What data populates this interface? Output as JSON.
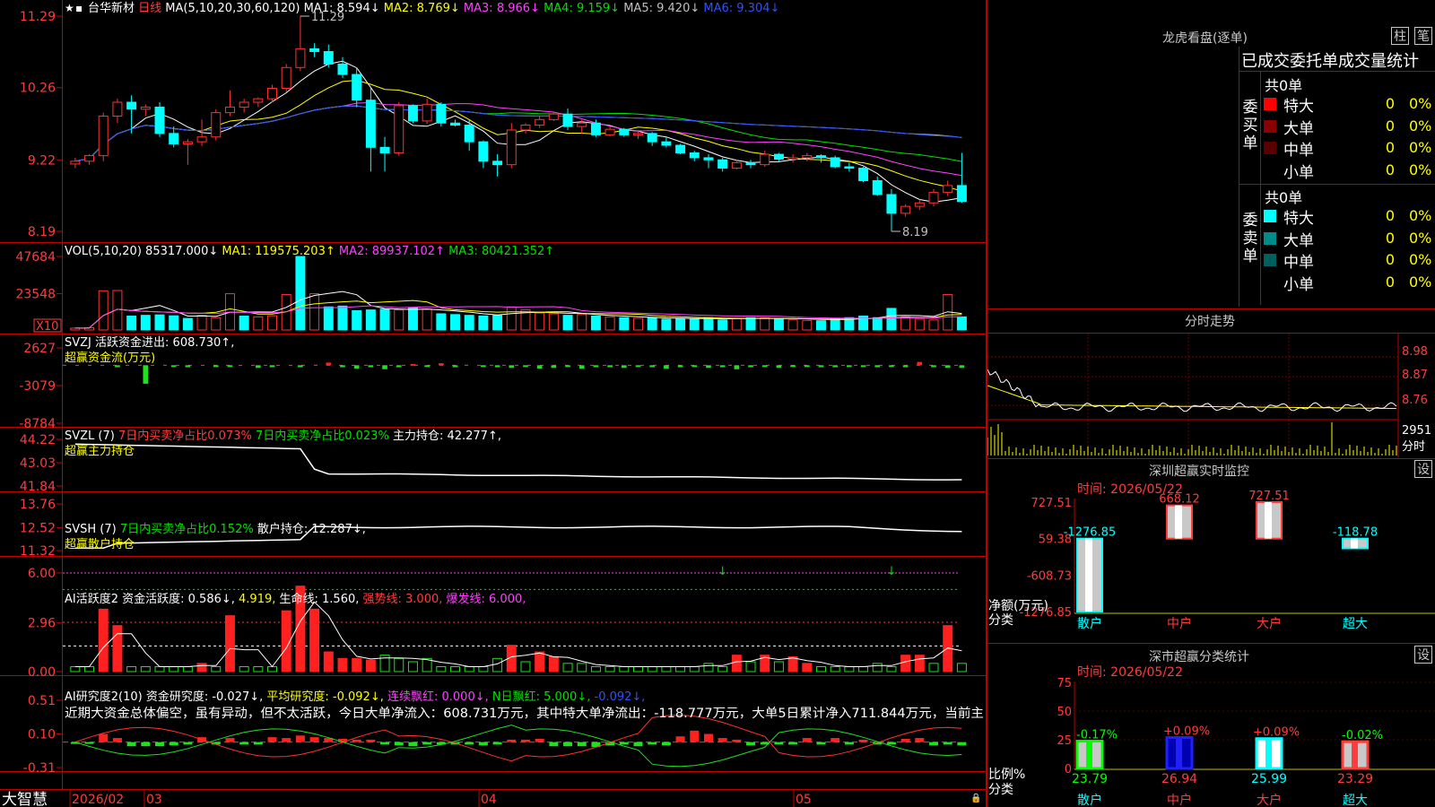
{
  "main": {
    "stock_name": "台华新材",
    "period": "日线",
    "ma_label": "MA(5,10,20,30,60,120)",
    "ma_items": [
      {
        "label": "MA1:",
        "value": "8.594↓",
        "color": "#ffffff"
      },
      {
        "label": "MA2:",
        "value": "8.769↓",
        "color": "#ffff00"
      },
      {
        "label": "MA3:",
        "value": "8.966↓",
        "color": "#ff40ff"
      },
      {
        "label": "MA4:",
        "value": "9.159↓",
        "color": "#00e000"
      },
      {
        "label": "MA5:",
        "value": "9.420↓",
        "color": "#c0c0c0"
      },
      {
        "label": "MA6:",
        "value": "9.304↓",
        "color": "#3050ff"
      }
    ],
    "y_ticks": [
      "11.29",
      "10.26",
      "9.22",
      "8.19"
    ],
    "high_label": "11.29",
    "low_label": "8.19"
  },
  "vol": {
    "header": "VOL(5,10,20)",
    "value": "85317.000↓",
    "ma1": "MA1: 119575.203↑",
    "ma2": "MA2: 89937.102↑",
    "ma3": "MA3: 80421.352↑",
    "y_ticks": [
      "47684",
      "23548"
    ],
    "unit": "X10"
  },
  "svzj": {
    "header": "SVZJ",
    "item": "活跃资金进出: 608.730↑,",
    "sub": "超赢资金流(万元)",
    "y_ticks": [
      "2627",
      "-3079",
      "-8784"
    ]
  },
  "svzl": {
    "header": "SVZL (7)",
    "item1": "7日内买卖净占比0.073%",
    "item2": "7日内买卖净占比0.023%",
    "item3": "主力持仓: 42.277↑,",
    "sub": "超赢主力持仓",
    "y_ticks": [
      "44.22",
      "43.03",
      "41.84"
    ]
  },
  "svsh": {
    "header": "SVSH (7)",
    "item1": "7日内买卖净占比0.152%",
    "item2": "散户持仓: 12.287↓,",
    "sub": "超赢散户持仓",
    "y_ticks": [
      "13.76",
      "12.52",
      "11.32"
    ]
  },
  "aihyd": {
    "header": "AI活跃度2",
    "item1": "资金活跃度: 0.586↓,",
    "item2": "4.919,",
    "item3": "生命线: 1.560,",
    "item4": "强势线: 3.000,",
    "item5": "爆发线: 6.000,",
    "y_ticks": [
      "6.00",
      "2.96",
      "0.00"
    ]
  },
  "aiyjd": {
    "header": "AI研究度2(10)",
    "item1": "资金研究度: -0.027↓,",
    "item2": "平均研究度: -0.092↓,",
    "item3": "连续飘红: 0.000↓,",
    "item4": "N日飘红: 5.000↓,",
    "item5": "-0.092↓,",
    "comment": "近期大资金总体偏空，虽有异动，但不太活跃，今日大单净流入：608.731万元，其中特大单净流出：-118.777万元，大单5日累计净入711.844万元，当前主",
    "y_ticks": [
      "0.51",
      "0.10",
      "-0.31"
    ]
  },
  "xaxis": {
    "brand": "大智慧",
    "labels": [
      "2026/02",
      "03",
      "04",
      "05"
    ]
  },
  "lhp": {
    "title": "龙虎看盘(逐单)",
    "tab1": "柱",
    "tab2": "笔",
    "heading": "已成交委托单成交量统计",
    "buy": {
      "vert": "委买单",
      "total": "共0单",
      "rows": [
        {
          "label": "特大",
          "value": "0",
          "pct": "0%",
          "color": "#ff0000"
        },
        {
          "label": "大单",
          "value": "0",
          "pct": "0%",
          "color": "#8b0000"
        },
        {
          "label": "中单",
          "value": "0",
          "pct": "0%",
          "color": "#5a0000"
        },
        {
          "label": "小单",
          "value": "0",
          "pct": "0%",
          "color": "#000000"
        }
      ]
    },
    "sell": {
      "vert": "委卖单",
      "total": "共0单",
      "rows": [
        {
          "label": "特大",
          "value": "0",
          "pct": "0%",
          "color": "#00ffff"
        },
        {
          "label": "大单",
          "value": "0",
          "pct": "0%",
          "color": "#008b8b"
        },
        {
          "label": "中单",
          "value": "0",
          "pct": "0%",
          "color": "#006060"
        },
        {
          "label": "小单",
          "value": "0",
          "pct": "0%",
          "color": "#000000"
        }
      ]
    }
  },
  "intraday": {
    "title": "分时走势",
    "price_ticks": [
      "8.98",
      "8.87",
      "8.76"
    ],
    "vol_tick": "2951",
    "unit": "分时"
  },
  "sz_monitor": {
    "title": "深圳超赢实时监控",
    "settings": "设",
    "time": "时间: 2026/05/22",
    "y_ticks": [
      "727.51",
      "59.38",
      "-608.73",
      "-1276.85"
    ],
    "ylabel": "净额(万元)",
    "xlabel": "分类",
    "categories": [
      "散户",
      "中户",
      "大户",
      "超大"
    ],
    "value_labels": [
      "-1276.85",
      "668.12",
      "727.51",
      "-118.78"
    ]
  },
  "sz_stats": {
    "title": "深市超赢分类统计",
    "settings": "设",
    "time": "时间: 2026/05/22",
    "y_ticks": [
      "75",
      "50",
      "25",
      "0"
    ],
    "ylabel": "比例%",
    "xlabel": "分类",
    "categories": [
      "散户",
      "中户",
      "大户",
      "超大"
    ],
    "pct_labels": [
      "-0.17%",
      "+0.09%",
      "+0.09%",
      "-0.02%"
    ],
    "value_labels": [
      "23.79",
      "26.94",
      "25.99",
      "23.29"
    ]
  },
  "chart_data": [
    {
      "type": "candlestick",
      "title": "台华新材 日线",
      "ylim": [
        8.19,
        11.29
      ],
      "ohlc": [
        [
          9.16,
          9.25,
          9.1,
          9.2
        ],
        [
          9.2,
          9.3,
          9.15,
          9.28
        ],
        [
          9.28,
          9.9,
          9.2,
          9.85
        ],
        [
          9.85,
          10.1,
          9.75,
          10.05
        ],
        [
          10.05,
          10.15,
          9.6,
          9.95
        ],
        [
          9.95,
          10.02,
          9.85,
          9.98
        ],
        [
          9.98,
          10.05,
          9.55,
          9.6
        ],
        [
          9.6,
          9.7,
          9.4,
          9.45
        ],
        [
          9.45,
          9.52,
          9.15,
          9.48
        ],
        [
          9.48,
          9.8,
          9.42,
          9.55
        ],
        [
          9.55,
          9.95,
          9.5,
          9.9
        ],
        [
          9.9,
          10.22,
          9.85,
          9.98
        ],
        [
          9.98,
          10.1,
          9.9,
          10.05
        ],
        [
          10.05,
          10.12,
          9.98,
          10.1
        ],
        [
          10.1,
          10.3,
          10.05,
          10.25
        ],
        [
          10.25,
          10.6,
          10.2,
          10.55
        ],
        [
          10.55,
          11.29,
          10.5,
          10.82
        ],
        [
          10.82,
          10.9,
          10.7,
          10.78
        ],
        [
          10.78,
          10.88,
          10.55,
          10.6
        ],
        [
          10.6,
          10.7,
          10.4,
          10.45
        ],
        [
          10.45,
          10.55,
          9.98,
          10.08
        ],
        [
          10.08,
          10.25,
          9.05,
          9.4
        ],
        [
          9.4,
          9.55,
          9.05,
          9.32
        ],
        [
          9.32,
          10.05,
          9.28,
          10.0
        ],
        [
          10.0,
          10.02,
          9.75,
          9.78
        ],
        [
          9.78,
          10.1,
          9.74,
          10.02
        ],
        [
          10.02,
          10.05,
          9.7,
          9.75
        ],
        [
          9.75,
          9.8,
          9.7,
          9.72
        ],
        [
          9.72,
          9.8,
          9.35,
          9.48
        ],
        [
          9.48,
          9.5,
          9.1,
          9.2
        ],
        [
          9.2,
          9.3,
          8.98,
          9.15
        ],
        [
          9.15,
          9.75,
          9.1,
          9.65
        ],
        [
          9.65,
          9.75,
          9.6,
          9.72
        ],
        [
          9.72,
          9.85,
          9.68,
          9.8
        ],
        [
          9.8,
          9.9,
          9.78,
          9.88
        ],
        [
          9.88,
          9.96,
          9.65,
          9.7
        ],
        [
          9.7,
          9.8,
          9.6,
          9.75
        ],
        [
          9.75,
          9.8,
          9.55,
          9.58
        ],
        [
          9.58,
          9.7,
          9.56,
          9.66
        ],
        [
          9.66,
          9.68,
          9.55,
          9.58
        ],
        [
          9.58,
          9.65,
          9.52,
          9.6
        ],
        [
          9.6,
          9.62,
          9.42,
          9.48
        ],
        [
          9.48,
          9.55,
          9.4,
          9.43
        ],
        [
          9.43,
          9.45,
          9.3,
          9.32
        ],
        [
          9.32,
          9.35,
          9.2,
          9.25
        ],
        [
          9.25,
          9.3,
          9.1,
          9.22
        ],
        [
          9.22,
          9.25,
          9.05,
          9.1
        ],
        [
          9.1,
          9.22,
          9.08,
          9.18
        ],
        [
          9.18,
          9.22,
          9.1,
          9.15
        ],
        [
          9.15,
          9.35,
          9.12,
          9.3
        ],
        [
          9.3,
          9.32,
          9.2,
          9.23
        ],
        [
          9.23,
          9.3,
          9.18,
          9.25
        ],
        [
          9.25,
          9.32,
          9.2,
          9.28
        ],
        [
          9.28,
          9.3,
          9.18,
          9.25
        ],
        [
          9.25,
          9.28,
          9.1,
          9.12
        ],
        [
          9.12,
          9.18,
          9.05,
          9.1
        ],
        [
          9.1,
          9.12,
          8.9,
          8.92
        ],
        [
          8.92,
          8.98,
          8.7,
          8.72
        ],
        [
          8.72,
          8.8,
          8.19,
          8.45
        ],
        [
          8.45,
          8.58,
          8.4,
          8.55
        ],
        [
          8.55,
          8.65,
          8.5,
          8.6
        ],
        [
          8.6,
          8.8,
          8.55,
          8.75
        ],
        [
          8.75,
          8.92,
          8.7,
          8.85
        ],
        [
          8.85,
          9.32,
          8.6,
          8.62
        ]
      ]
    },
    {
      "type": "bar",
      "title": "VOL(5,10,20)",
      "ylim": [
        0,
        47684
      ],
      "values": [
        1200,
        1500,
        25400,
        25600,
        9000,
        9500,
        9800,
        9200,
        7500,
        9500,
        8000,
        23500,
        9000,
        8500,
        9200,
        23000,
        47684,
        23500,
        15000,
        15500,
        12500,
        13000,
        13500,
        13000,
        14500,
        13500,
        10500,
        10000,
        9500,
        9000,
        9500,
        15000,
        13000,
        11000,
        10500,
        9500,
        10000,
        9000,
        8500,
        8000,
        7500,
        8000,
        7000,
        7500,
        7000,
        8000,
        6500,
        7500,
        8000,
        7800,
        7500,
        6500,
        6200,
        6000,
        7500,
        8000,
        9000,
        8000,
        14000,
        8500,
        7000,
        6500,
        23000,
        8500
      ],
      "up": [
        1,
        1,
        1,
        1,
        0,
        0,
        0,
        0,
        0,
        1,
        1,
        1,
        0,
        1,
        1,
        1,
        0,
        1,
        0,
        0,
        0,
        0,
        0,
        1,
        0,
        1,
        0,
        0,
        0,
        0,
        0,
        1,
        1,
        1,
        1,
        0,
        1,
        0,
        1,
        0,
        1,
        0,
        0,
        0,
        0,
        0,
        0,
        1,
        0,
        1,
        0,
        1,
        1,
        0,
        0,
        0,
        0,
        0,
        0,
        1,
        1,
        1,
        1,
        0
      ]
    },
    {
      "type": "bar",
      "title": "SVZJ",
      "ylim": [
        -8784,
        2627
      ],
      "values": [
        0,
        0,
        0,
        -300,
        0,
        -2800,
        0,
        -200,
        -300,
        0,
        -200,
        -200,
        0,
        -400,
        -300,
        0,
        -300,
        0,
        400,
        -300,
        -500,
        -300,
        -600,
        -300,
        200,
        -200,
        300,
        -300,
        0,
        -200,
        -300,
        -400,
        -200,
        -500,
        -400,
        -200,
        -500,
        -300,
        -300,
        -400,
        -200,
        -300,
        -500,
        -300,
        -200,
        -400,
        -300,
        -600,
        -300,
        -200,
        -400,
        -200,
        -200,
        -300,
        -300,
        -200,
        -200,
        -300,
        -200,
        -300,
        500,
        -300,
        -400,
        -400
      ]
    },
    {
      "type": "line",
      "title": "SVZL (7)",
      "ylim": [
        41.84,
        44.22
      ]
    },
    {
      "type": "line",
      "title": "SVSH (7)",
      "ylim": [
        11.32,
        13.76
      ]
    },
    {
      "type": "bar",
      "title": "AI活跃度2",
      "ylim": [
        0,
        6.0
      ],
      "values": [
        0.3,
        0.3,
        3.8,
        2.8,
        0.3,
        0.3,
        0.3,
        0.3,
        0.3,
        0.5,
        0.3,
        3.4,
        0.3,
        0.3,
        0.3,
        3.7,
        5.2,
        3.8,
        1.2,
        0.8,
        0.8,
        0.7,
        1.0,
        0.8,
        0.6,
        0.8,
        0.3,
        0.3,
        0.3,
        0.3,
        0.8,
        1.6,
        0.6,
        1.2,
        0.9,
        0.5,
        0.5,
        0.3,
        0.3,
        0.3,
        0.3,
        0.3,
        0.3,
        0.3,
        0.3,
        0.5,
        0.3,
        1.0,
        0.6,
        1.0,
        0.6,
        0.9,
        0.5,
        0.3,
        0.3,
        0.3,
        0.3,
        0.5,
        0.3,
        1.0,
        1.0,
        0.5,
        2.8,
        0.5
      ],
      "up": [
        0,
        0,
        1,
        1,
        0,
        0,
        0,
        0,
        0,
        1,
        0,
        1,
        0,
        0,
        0,
        1,
        1,
        1,
        1,
        1,
        1,
        1,
        0,
        0,
        0,
        0,
        0,
        0,
        0,
        0,
        0,
        1,
        0,
        1,
        1,
        0,
        0,
        0,
        0,
        0,
        0,
        0,
        0,
        0,
        0,
        0,
        0,
        1,
        0,
        1,
        0,
        1,
        1,
        0,
        0,
        0,
        0,
        0,
        0,
        1,
        1,
        0,
        1,
        0
      ]
    },
    {
      "type": "bar",
      "title": "AI研究度2(10)",
      "ylim": [
        -0.31,
        0.51
      ],
      "values": [
        0,
        0,
        0.1,
        0.05,
        -0.05,
        -0.05,
        -0.05,
        -0.04,
        -0.03,
        0.06,
        -0.03,
        0.05,
        -0.03,
        -0.03,
        0.06,
        0.05,
        0.08,
        0.06,
        0.05,
        0.04,
        0.03,
        0.03,
        -0.03,
        -0.04,
        -0.05,
        -0.03,
        -0.03,
        -0.03,
        -0.03,
        -0.04,
        -0.03,
        0.03,
        0.03,
        0.04,
        -0.05,
        -0.05,
        -0.05,
        -0.06,
        -0.04,
        -0.03,
        -0.05,
        -0.03,
        -0.04,
        0.07,
        0.14,
        0.1,
        0.05,
        0.03,
        -0.04,
        -0.03,
        -0.03,
        -0.03,
        0.05,
        -0.03,
        0.05,
        -0.03,
        0.03,
        -0.03,
        -0.03,
        0.04,
        0.05,
        -0.04,
        -0.03,
        -0.04
      ]
    },
    {
      "type": "bar",
      "title": "深圳超赢实时监控",
      "categories": [
        "散户",
        "中户",
        "大户",
        "超大"
      ],
      "values": [
        -1276.85,
        668.12,
        727.51,
        -118.78
      ],
      "ylim": [
        -1276.85,
        727.51
      ]
    },
    {
      "type": "bar",
      "title": "深市超赢分类统计",
      "categories": [
        "散户",
        "中户",
        "大户",
        "超大"
      ],
      "values": [
        23.79,
        26.94,
        25.99,
        23.29
      ],
      "ylim": [
        0,
        75
      ]
    }
  ]
}
